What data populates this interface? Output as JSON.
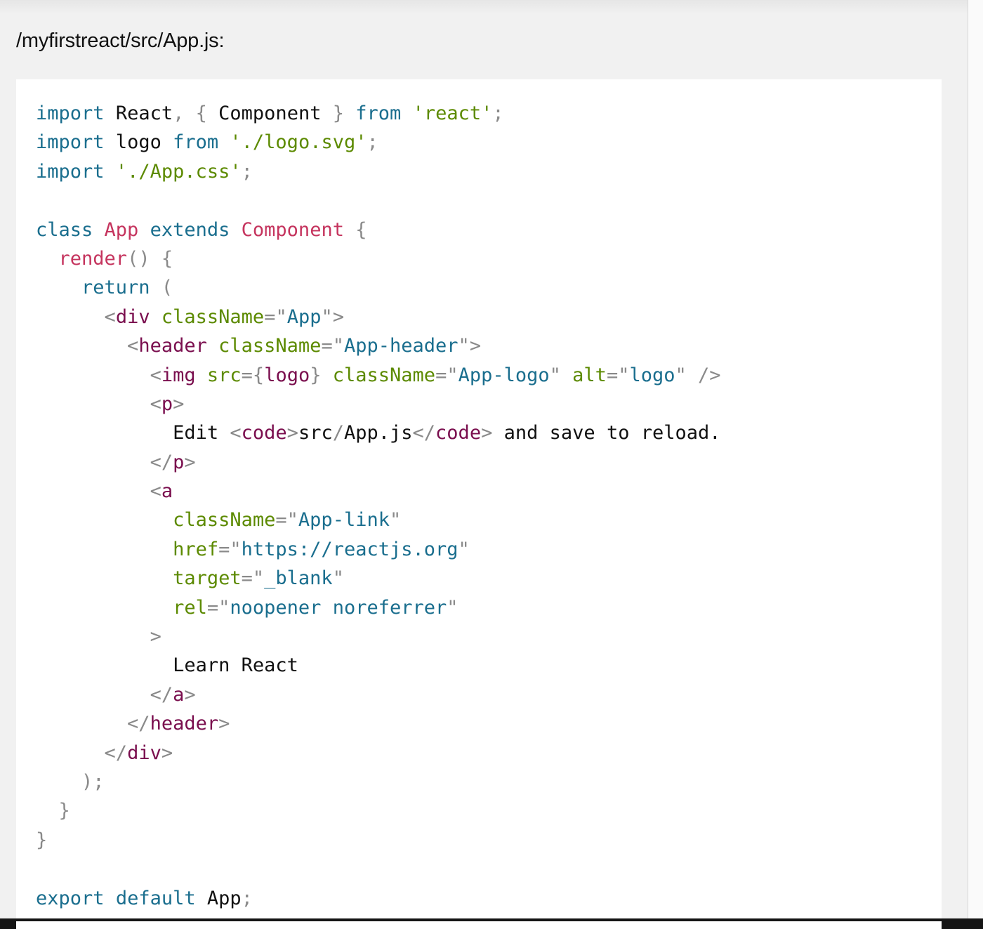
{
  "file_path": "/myfirstreact/src/App.js:",
  "code": {
    "language": "javascript",
    "lines": [
      "import React, { Component } from 'react';",
      "import logo from './logo.svg';",
      "import './App.css';",
      "",
      "class App extends Component {",
      "  render() {",
      "    return (",
      "      <div className=\"App\">",
      "        <header className=\"App-header\">",
      "          <img src={logo} className=\"App-logo\" alt=\"logo\" />",
      "          <p>",
      "            Edit <code>src/App.js</code> and save to reload.",
      "          </p>",
      "          <a",
      "            className=\"App-link\"",
      "            href=\"https://reactjs.org\"",
      "            target=\"_blank\"",
      "            rel=\"noopener noreferrer\"",
      "          >",
      "            Learn React",
      "          </a>",
      "        </header>",
      "      </div>",
      "    );",
      "  }",
      "}",
      "",
      "export default App;"
    ]
  },
  "colors": {
    "keyword": "#1a6e8e",
    "string": "#5c8a00",
    "class_name": "#c5345e",
    "punctuation": "#8a8a8a",
    "jsx_tag": "#7a0e4e",
    "jsx_attr": "#5c8a00",
    "jsx_attr_value": "#1a6e8e",
    "panel_background": "#ffffff",
    "page_background": "#f1f1f1"
  }
}
